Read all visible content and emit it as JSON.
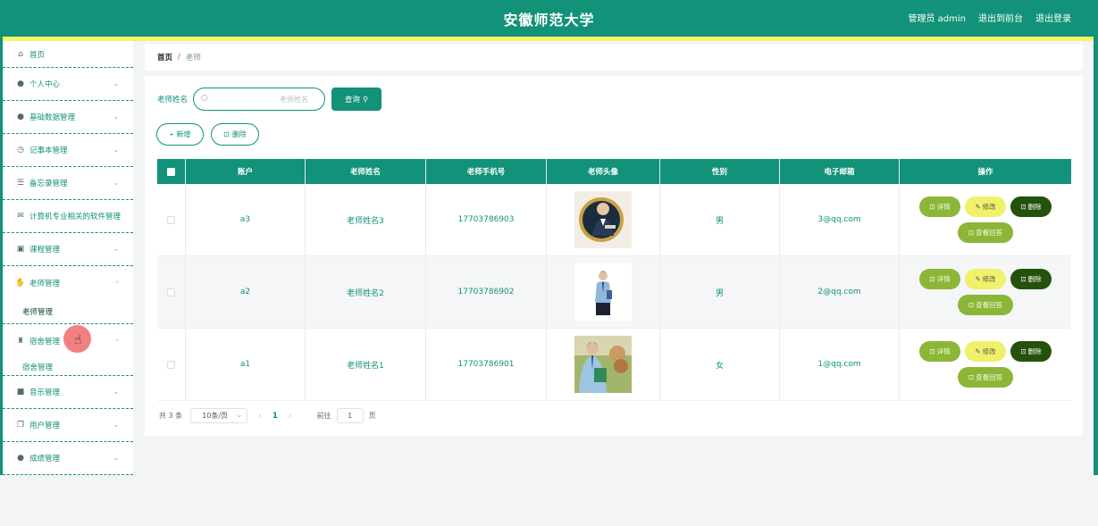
{
  "header": {
    "title": "安徽师范大学",
    "admin_label": "管理员 admin",
    "to_front_label": "退出到前台",
    "logout_label": "退出登录"
  },
  "sidebar": {
    "items": [
      {
        "label": "首页",
        "icon": "home-icon"
      },
      {
        "label": "个人中心",
        "icon": "user-icon"
      },
      {
        "label": "基础数据管理",
        "icon": "user-icon"
      },
      {
        "label": "记事本管理",
        "icon": "clock-icon"
      },
      {
        "label": "备忘录管理",
        "icon": "sliders-icon"
      },
      {
        "label": "计算机专业相关的软件管理",
        "icon": "mail-icon"
      },
      {
        "label": "课程管理",
        "icon": "briefcase-icon"
      },
      {
        "label": "老师管理",
        "icon": "thumb-icon"
      },
      {
        "label": "宿舍管理",
        "icon": "trophy-icon"
      },
      {
        "label": "音乐管理",
        "icon": "monitor-icon"
      },
      {
        "label": "用户管理",
        "icon": "copy-icon"
      },
      {
        "label": "成绩管理",
        "icon": "user-icon"
      }
    ],
    "teacher_sub": "老师管理",
    "dorm_sub": "宿舍管理"
  },
  "breadcrumb": {
    "home": "首页",
    "sep": "/",
    "current": "老师"
  },
  "search": {
    "label": "老师姓名",
    "placeholder": "老师姓名",
    "button": "查询"
  },
  "actions": {
    "add": "新增",
    "delete": "删除"
  },
  "table": {
    "headers": [
      "账户",
      "老师姓名",
      "老师手机号",
      "老师头像",
      "性别",
      "电子邮箱",
      "操作"
    ],
    "rows": [
      {
        "account": "a3",
        "name": "老师姓名3",
        "phone": "17703786903",
        "gender": "男",
        "email": "3@qq.com"
      },
      {
        "account": "a2",
        "name": "老师姓名2",
        "phone": "17703786902",
        "gender": "男",
        "email": "2@qq.com"
      },
      {
        "account": "a1",
        "name": "老师姓名1",
        "phone": "17703786901",
        "gender": "女",
        "email": "1@qq.com"
      }
    ],
    "ops": {
      "detail": "详情",
      "edit": "修改",
      "remove": "删除",
      "view": "查看回答"
    }
  },
  "pagination": {
    "total": "共 3 条",
    "page_size": "10条/页",
    "current": "1",
    "goto_label": "前往",
    "goto_value": "1",
    "page_unit": "页"
  },
  "colors": {
    "primary": "#129278",
    "accent_yellow": "#f4f56a",
    "button_green": "#8bb637",
    "button_dark": "#24520d"
  }
}
